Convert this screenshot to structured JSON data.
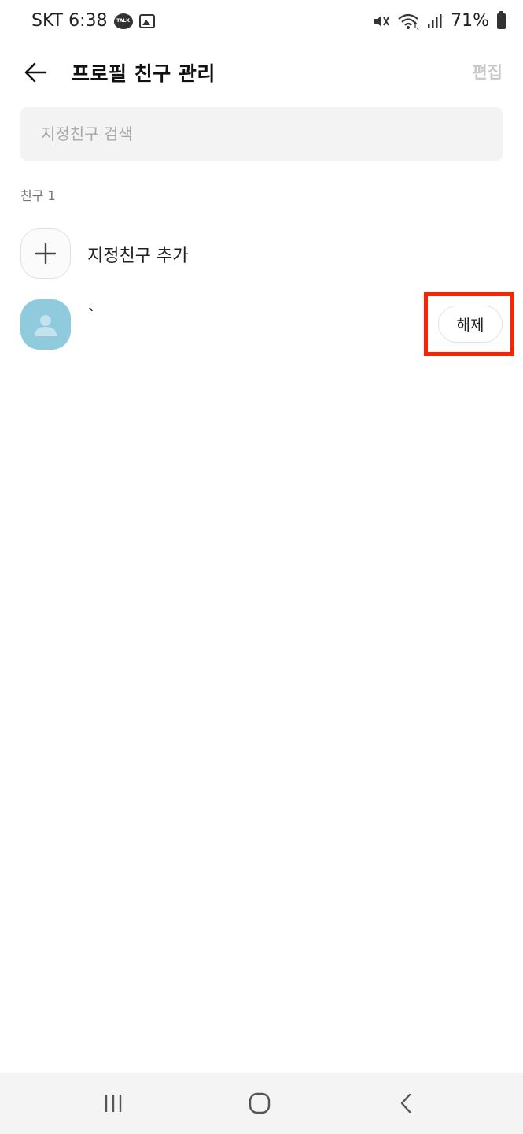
{
  "status_bar": {
    "carrier_time": "SKT 6:38",
    "talk_badge": "TALK",
    "battery_percent": "71%",
    "icons": [
      "kakaotalk-notification-icon",
      "gallery-icon",
      "mute-icon",
      "wifi-icon",
      "signal-icon",
      "battery-icon"
    ]
  },
  "header": {
    "title": "프로필 친구 관리",
    "edit_label": "편집",
    "back_icon": "back-arrow-icon"
  },
  "search": {
    "placeholder": "지정친구 검색",
    "value": ""
  },
  "section": {
    "label": "친구 1"
  },
  "add_item": {
    "label": "지정친구 추가",
    "icon": "plus-icon"
  },
  "friends": [
    {
      "name": "`",
      "action_label": "해제",
      "avatar_icon": "default-avatar-icon"
    }
  ],
  "highlight": {
    "color": "#ff2200"
  },
  "nav": {
    "icons": [
      "recent-apps-icon",
      "home-icon",
      "back-icon"
    ]
  },
  "colors": {
    "accent_disabled": "#c8c8c8",
    "avatar_bg": "#8fcbdc",
    "search_bg": "#f3f3f3"
  }
}
